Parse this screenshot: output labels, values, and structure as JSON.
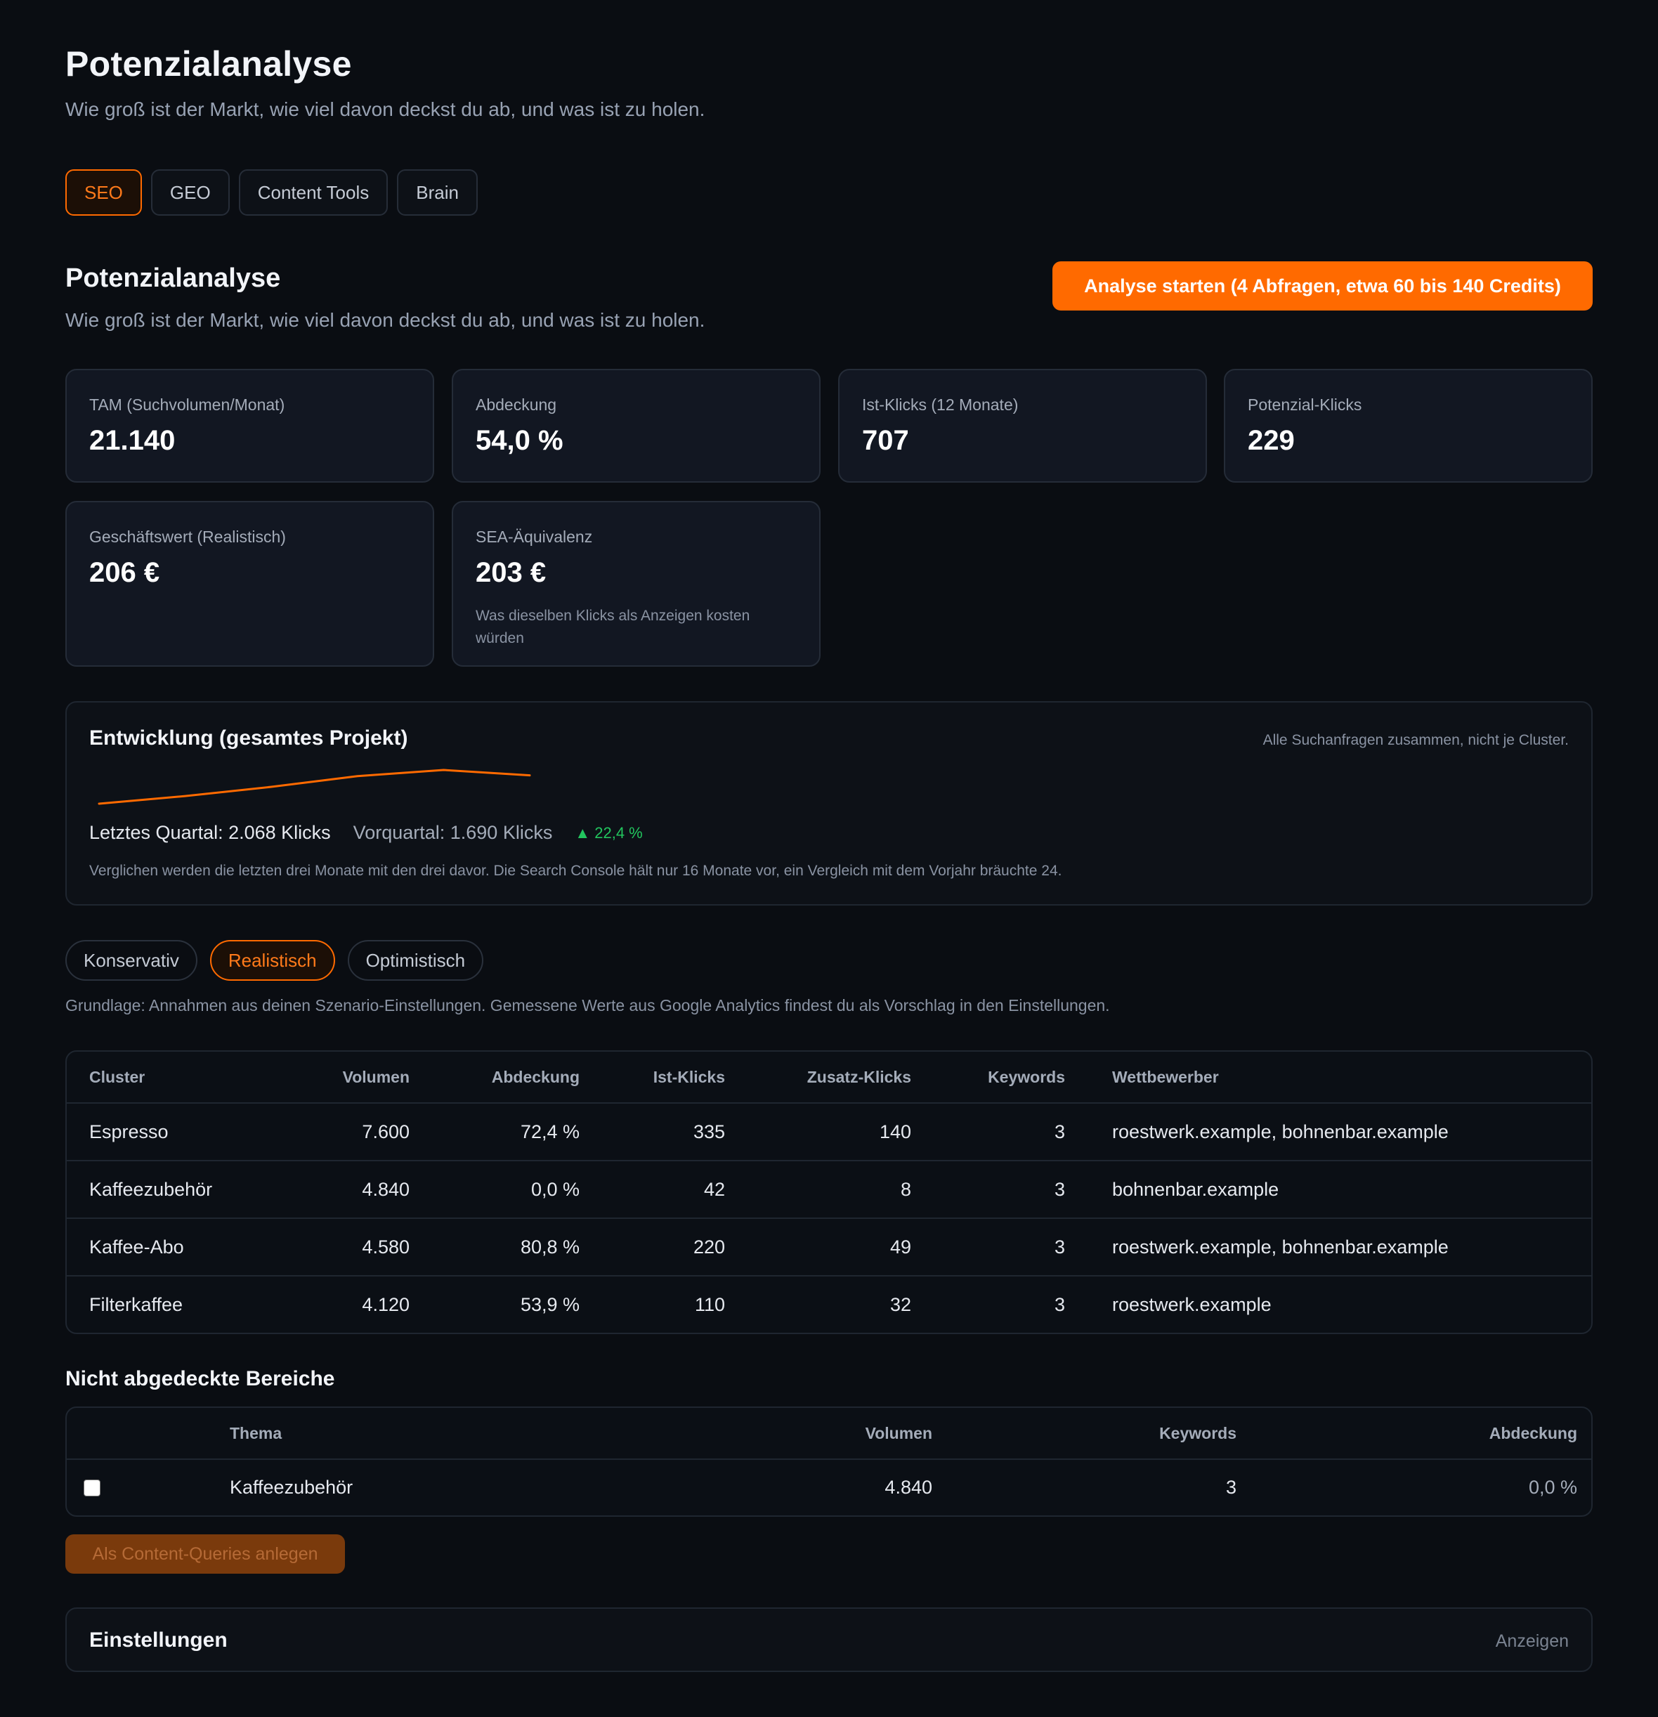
{
  "header": {
    "title": "Potenzialanalyse",
    "subtitle": "Wie groß ist der Markt, wie viel davon deckst du ab, und was ist zu holen."
  },
  "tabs": [
    {
      "label": "SEO",
      "active": true
    },
    {
      "label": "GEO",
      "active": false
    },
    {
      "label": "Content Tools",
      "active": false
    },
    {
      "label": "Brain",
      "active": false
    }
  ],
  "section": {
    "title": "Potenzialanalyse",
    "subtitle": "Wie groß ist der Markt, wie viel davon deckst du ab, und was ist zu holen.",
    "start_button": "Analyse starten (4 Abfragen, etwa 60 bis 140 Credits)"
  },
  "kpis": [
    {
      "label": "TAM (Suchvolumen/Monat)",
      "value": "21.140"
    },
    {
      "label": "Abdeckung",
      "value": "54,0 %"
    },
    {
      "label": "Ist-Klicks (12 Monate)",
      "value": "707"
    },
    {
      "label": "Potenzial-Klicks",
      "value": "229"
    },
    {
      "label": "Geschäftswert (Realistisch)",
      "value": "206 €"
    },
    {
      "label": "SEA-Äquivalenz",
      "value": "203 €",
      "note": "Was dieselben Klicks als Anzeigen kosten würden"
    }
  ],
  "development": {
    "title": "Entwicklung (gesamtes Projekt)",
    "hint": "Alle Suchanfragen zusammen, nicht je Cluster.",
    "last_quarter": "Letztes Quartal: 2.068 Klicks",
    "previous_quarter": "Vorquartal: 1.690 Klicks",
    "trend": "▲ 22,4 %",
    "note": "Verglichen werden die letzten drei Monate mit den drei davor. Die Search Console hält nur 16 Monate vor, ein Vergleich mit dem Vorjahr bräuchte 24.",
    "sparkline_color": "#ff6a00"
  },
  "chart_data": {
    "type": "line",
    "x": [
      1,
      2,
      3,
      4,
      5,
      6
    ],
    "values": [
      1,
      2,
      3.2,
      4.6,
      5.4,
      4.7
    ]
  },
  "scenarios": [
    {
      "label": "Konservativ",
      "active": false
    },
    {
      "label": "Realistisch",
      "active": true
    },
    {
      "label": "Optimistisch",
      "active": false
    }
  ],
  "basis": "Grundlage: Annahmen aus deinen Szenario-Einstellungen. Gemessene Werte aus Google Analytics findest du als Vorschlag in den Einstellungen.",
  "cluster_table": {
    "columns": [
      "Cluster",
      "Volumen",
      "Abdeckung",
      "Ist-Klicks",
      "Zusatz-Klicks",
      "Keywords",
      "Wettbewerber"
    ],
    "rows": [
      [
        "Espresso",
        "7.600",
        "72,4 %",
        "335",
        "140",
        "3",
        "roestwerk.example, bohnenbar.example"
      ],
      [
        "Kaffeezubehör",
        "4.840",
        "0,0 %",
        "42",
        "8",
        "3",
        "bohnenbar.example"
      ],
      [
        "Kaffee-Abo",
        "4.580",
        "80,8 %",
        "220",
        "49",
        "3",
        "roestwerk.example, bohnenbar.example"
      ],
      [
        "Filterkaffee",
        "4.120",
        "53,9 %",
        "110",
        "32",
        "3",
        "roestwerk.example"
      ]
    ]
  },
  "gaps": {
    "title": "Nicht abgedeckte Bereiche",
    "columns": [
      "Thema",
      "Volumen",
      "Keywords",
      "Abdeckung"
    ],
    "rows": [
      {
        "checked": false,
        "topic": "Kaffeezubehör",
        "volume": "4.840",
        "keywords": "3",
        "coverage": "0,0 %"
      }
    ],
    "button": "Als Content-Queries anlegen"
  },
  "settings": {
    "title": "Einstellungen",
    "action": "Anzeigen"
  },
  "colors": {
    "accent": "#ff6a00",
    "positive": "#22c55e",
    "background": "#0a0d12"
  }
}
